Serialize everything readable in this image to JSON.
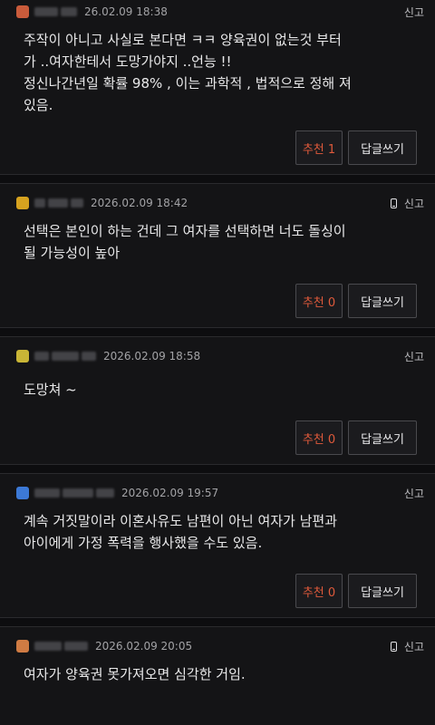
{
  "comments": [
    {
      "date": "26.02.09 18:38",
      "report_label": "신고",
      "lines": [
        "주작이 아니고 사실로 본다면 ㅋㅋ 양육권이 없는것 부터",
        "가 ..여자한테서 도망가야지 ..언능 !!",
        "정신나간년일 확률 98% , 이는 과학적 , 법적으로 정해 져",
        "있음."
      ],
      "recommend_label": "추천 1",
      "reply_label": "답글쓰기",
      "avatar_color": "#c95b3b"
    },
    {
      "date": "2026.02.09 18:42",
      "report_label": "신고",
      "lines": [
        "선택은 본인이 하는 건데 그 여자를 선택하면 너도 돌싱이",
        "될 가능성이 높아"
      ],
      "recommend_label": "추천 0",
      "reply_label": "답글쓰기",
      "avatar_color": "#d6a21f"
    },
    {
      "date": "2026.02.09 18:58",
      "report_label": "신고",
      "lines": [
        "도망쳐 ~"
      ],
      "recommend_label": "추천 0",
      "reply_label": "답글쓰기",
      "avatar_color": "#c9b536"
    },
    {
      "date": "2026.02.09 19:57",
      "report_label": "신고",
      "lines": [
        "계속 거짓말이라 이혼사유도  남편이 아닌 여자가 남편과",
        "아이에게 가정 폭력을 행사했을 수도 있음."
      ],
      "recommend_label": "추천 0",
      "reply_label": "답글쓰기",
      "avatar_color": "#3c79d6"
    },
    {
      "date": "2026.02.09 20:05",
      "report_label": "신고",
      "lines": [
        "여자가 양육권 못가져오면 심각한 거임."
      ],
      "avatar_color": "#cf7b43"
    }
  ]
}
